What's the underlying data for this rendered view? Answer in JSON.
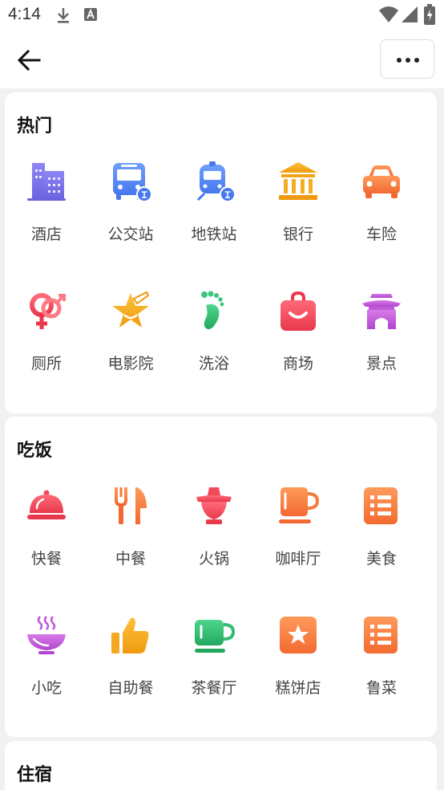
{
  "status_bar": {
    "time": "4:14",
    "icons": [
      "download-icon",
      "font-a-icon",
      "wifi-icon",
      "signal-icon",
      "battery-icon"
    ]
  },
  "header": {
    "back_icon": "arrow-left-icon",
    "more_icon": "more-dots-icon"
  },
  "sections": [
    {
      "title": "热门",
      "items": [
        {
          "label": "酒店",
          "icon": "hotel-icon"
        },
        {
          "label": "公交站",
          "icon": "bus-icon"
        },
        {
          "label": "地铁站",
          "icon": "subway-icon"
        },
        {
          "label": "银行",
          "icon": "bank-icon"
        },
        {
          "label": "车险",
          "icon": "car-icon"
        },
        {
          "label": "厕所",
          "icon": "toilet-icon"
        },
        {
          "label": "电影院",
          "icon": "cinema-icon"
        },
        {
          "label": "洗浴",
          "icon": "bath-icon"
        },
        {
          "label": "商场",
          "icon": "mall-icon"
        },
        {
          "label": "景点",
          "icon": "scenic-icon"
        }
      ]
    },
    {
      "title": "吃饭",
      "items": [
        {
          "label": "快餐",
          "icon": "cloche-icon"
        },
        {
          "label": "中餐",
          "icon": "fork-knife-icon"
        },
        {
          "label": "火锅",
          "icon": "hotpot-icon"
        },
        {
          "label": "咖啡厅",
          "icon": "coffee-icon"
        },
        {
          "label": "美食",
          "icon": "menu-list-icon"
        },
        {
          "label": "小吃",
          "icon": "snack-bowl-icon"
        },
        {
          "label": "自助餐",
          "icon": "thumbs-up-icon"
        },
        {
          "label": "茶餐厅",
          "icon": "tea-cup-icon"
        },
        {
          "label": "糕饼店",
          "icon": "star-box-icon"
        },
        {
          "label": "鲁菜",
          "icon": "menu-list-icon"
        }
      ]
    },
    {
      "title": "住宿",
      "items": []
    }
  ],
  "colors": {
    "blue": "#5a86f2",
    "purple": "#7b72e8",
    "gold": "#f4a720",
    "orange": "#f47a3d",
    "red": "#ef4b5c",
    "green": "#2fbf70",
    "violet": "#c058d8"
  }
}
